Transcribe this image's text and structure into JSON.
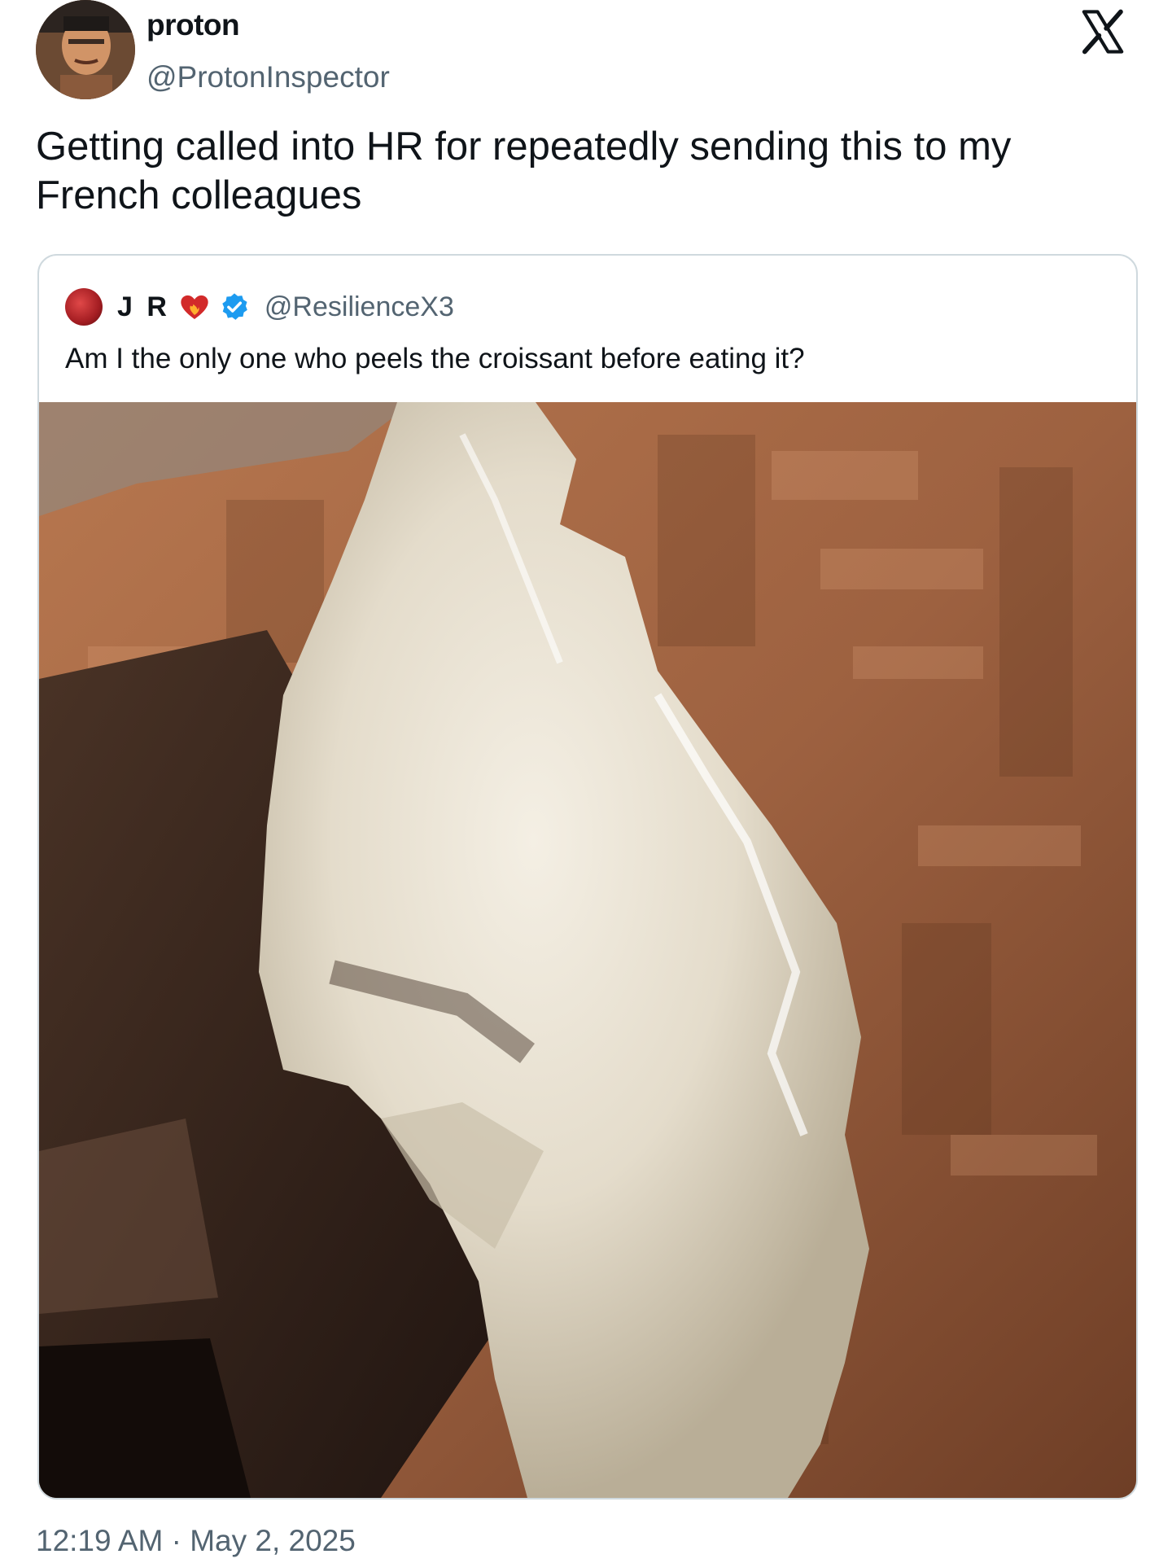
{
  "author": {
    "display_name": "proton",
    "handle": "@ProtonInspector",
    "avatar_icon": "portrait-avatar"
  },
  "brand": {
    "logo": "x-logo"
  },
  "tweet": {
    "text": "Getting called into HR for repeatedly sending this to my French colleagues",
    "timestamp": "12:19 AM · May 2, 2025"
  },
  "quoted": {
    "display_name": "J R",
    "handle": "@ResilienceX3",
    "text": "Am I the only one who peels the croissant before eating it?",
    "badges": [
      "burning-heart-emoji",
      "verified-badge-icon"
    ],
    "verified_color": "#1d9bf0",
    "media_icon": "photo-peeled-croissant"
  }
}
